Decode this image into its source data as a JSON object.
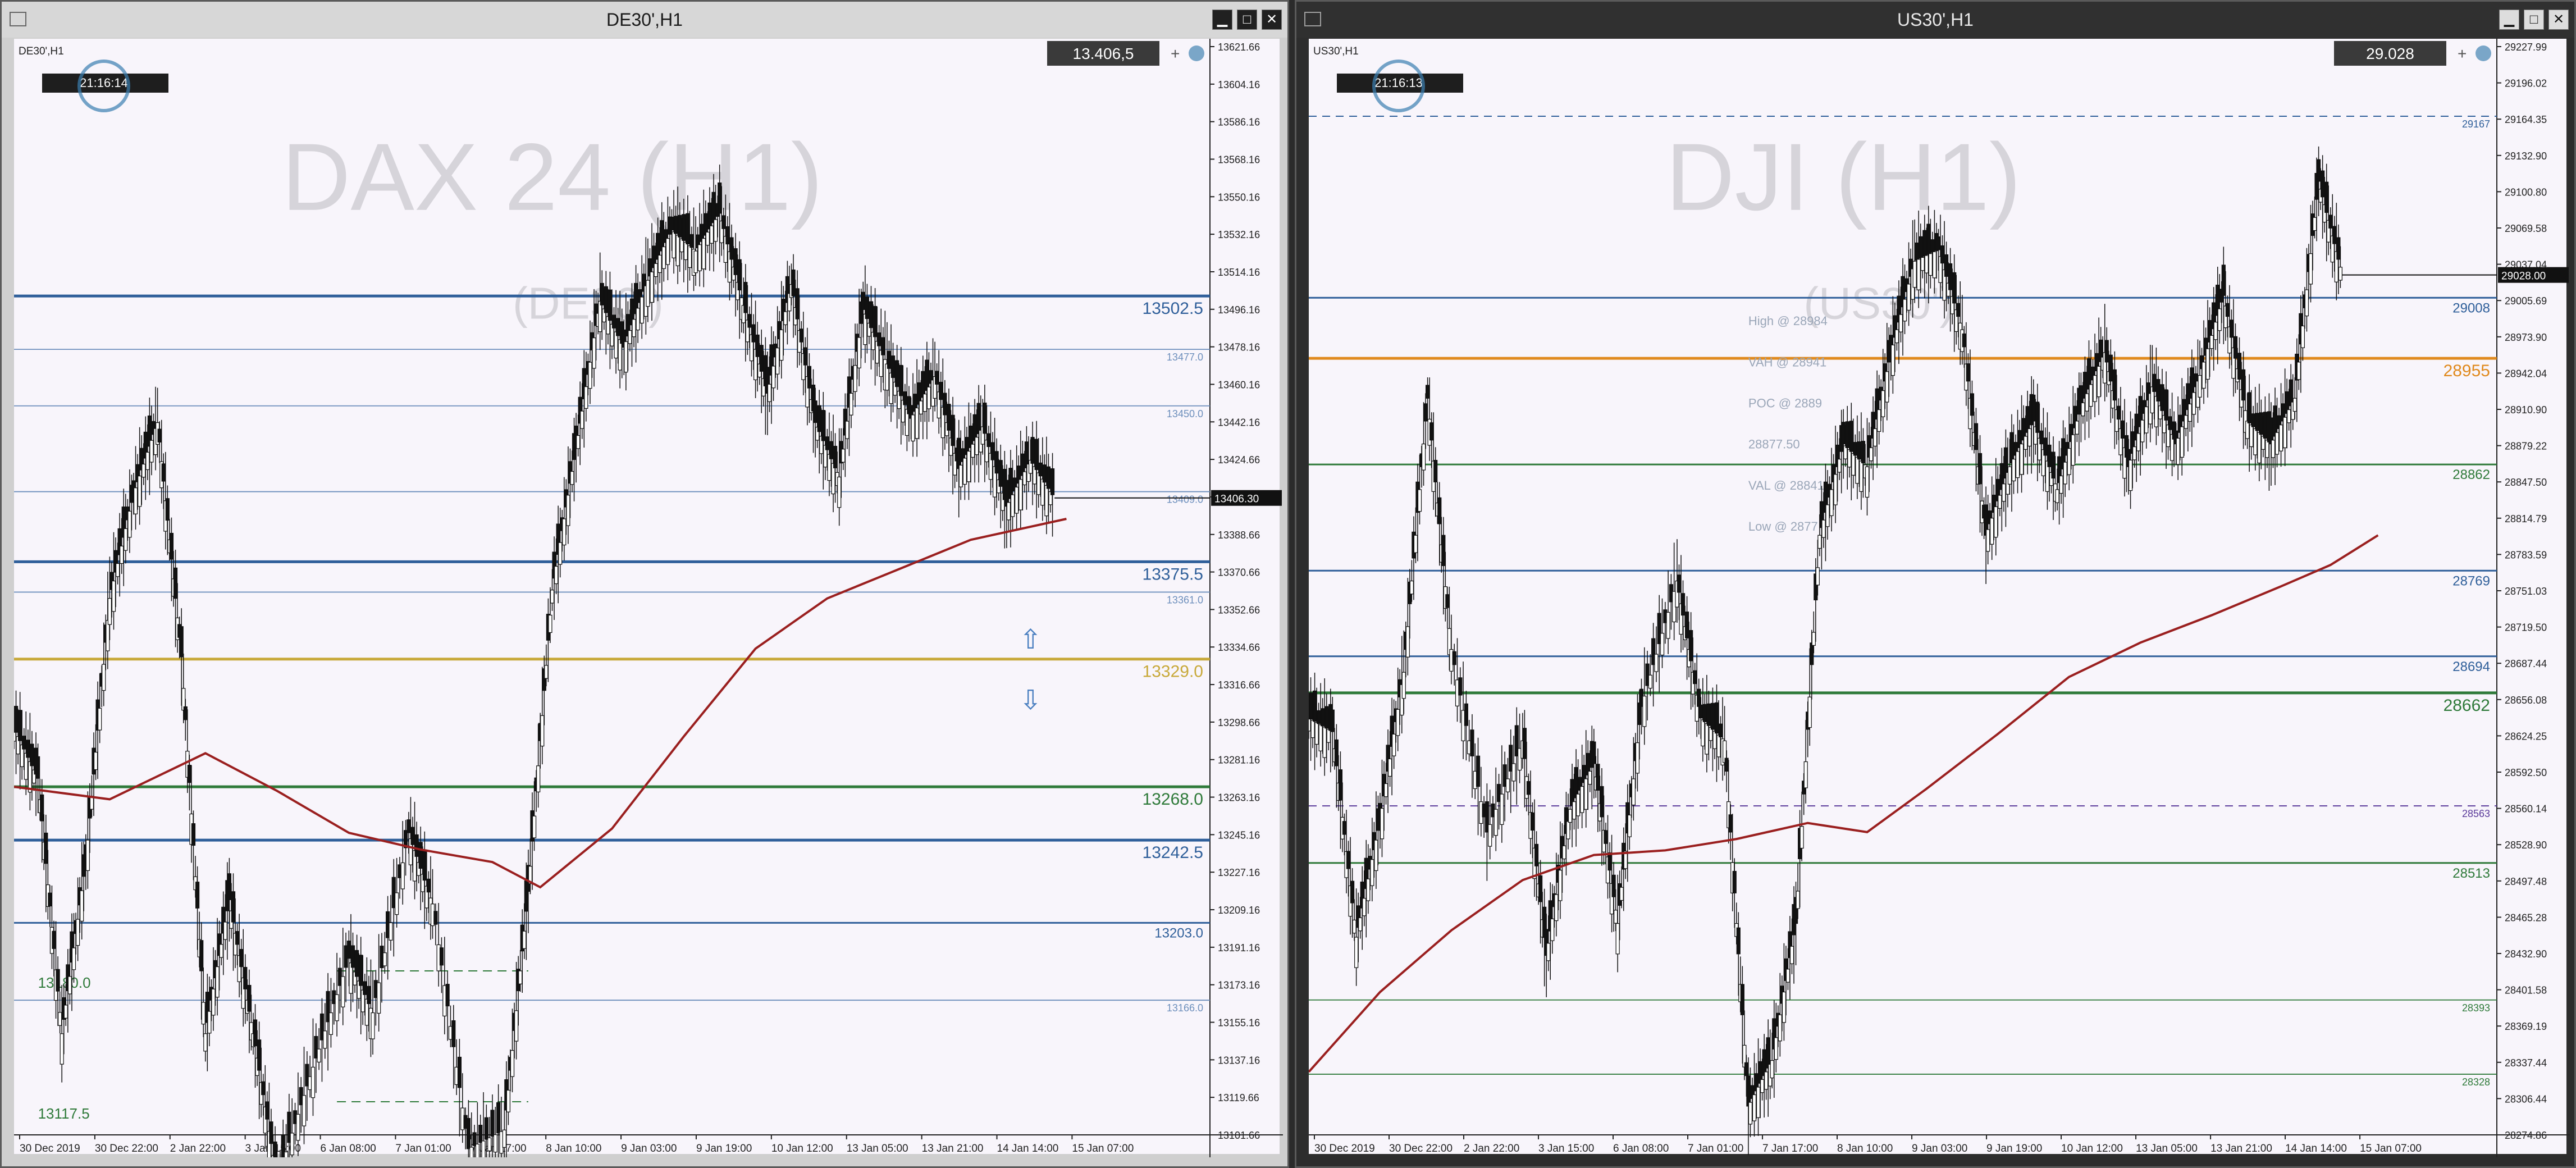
{
  "colors": {
    "price_line": "#2f5f9a",
    "res_light": "#6d8fbc",
    "yellow": "#c8a93a",
    "green": "#2f7a3a",
    "orange": "#e08a1e",
    "purple": "#5a3a9a",
    "ma": "#9a1f1f",
    "candle": "#111111",
    "watermark": "#d6d4da"
  },
  "windows": [
    {
      "title": "DE30',H1",
      "buttons": [
        "▁",
        "□",
        "✕"
      ],
      "icon": "window-icon"
    },
    {
      "title": "US30',H1",
      "buttons": [
        "▁",
        "□",
        "✕"
      ],
      "icon": "window-icon"
    }
  ],
  "chart_data": [
    {
      "type": "candlestick",
      "title": "DE30',H1",
      "watermark": [
        "DAX 24 (H1)",
        "(DE30')"
      ],
      "clock": "21:16:14",
      "price_box": "13.406,5",
      "current_price_tag": "13406.30",
      "ylim": [
        13101.66,
        13621.66
      ],
      "y_ticks": [
        "13621.66",
        "13604.16",
        "13586.16",
        "13568.16",
        "13550.16",
        "13532.16",
        "13514.16",
        "13496.16",
        "13478.16",
        "13460.16",
        "13442.16",
        "13424.66",
        "13406.66",
        "13388.66",
        "13370.66",
        "13352.66",
        "13334.66",
        "13316.66",
        "13298.66",
        "13281.16",
        "13263.16",
        "13245.16",
        "13227.16",
        "13209.16",
        "13191.16",
        "13173.16",
        "13155.16",
        "13137.16",
        "13119.66",
        "13101.66"
      ],
      "x_ticks": [
        "30 Dec 2019",
        "30 Dec 22:00",
        "2 Jan 22:00",
        "3 Jan 15:00",
        "6 Jan 08:00",
        "7 Jan 01:00",
        "7 Jan 17:00",
        "8 Jan 10:00",
        "9 Jan 03:00",
        "9 Jan 19:00",
        "10 Jan 12:00",
        "13 Jan 05:00",
        "13 Jan 21:00",
        "14 Jan 14:00",
        "15 Jan 07:00"
      ],
      "levels": [
        {
          "label": "13502.5",
          "value": 13502.5,
          "style": "thick",
          "color": "price_line"
        },
        {
          "label": "13477.0",
          "value": 13477,
          "style": "thin",
          "color": "res_light"
        },
        {
          "label": "13450.0",
          "value": 13450,
          "style": "thin",
          "color": "res_light"
        },
        {
          "label": "13409.0",
          "value": 13409,
          "style": "thin",
          "color": "res_light"
        },
        {
          "label": "13375.5",
          "value": 13375.5,
          "style": "thick",
          "color": "price_line"
        },
        {
          "label": "13361.0",
          "value": 13361,
          "style": "thin",
          "color": "res_light"
        },
        {
          "label": "13329.0",
          "value": 13329,
          "style": "thick",
          "color": "yellow"
        },
        {
          "label": "13268.0",
          "value": 13268,
          "style": "thick",
          "color": "green"
        },
        {
          "label": "13242.5",
          "value": 13242.5,
          "style": "thick",
          "color": "price_line"
        },
        {
          "label": "13203.0",
          "value": 13203,
          "style": "mid",
          "color": "price_line"
        },
        {
          "label": "13166.0",
          "value": 13166,
          "style": "thin",
          "color": "res_light"
        }
      ],
      "side_labels": [
        {
          "label": "13180.0",
          "value": 13180,
          "color": "green"
        },
        {
          "label": "13117.5",
          "value": 13117.5,
          "color": "green"
        }
      ],
      "ma_path": [
        [
          0,
          13268
        ],
        [
          0.08,
          13262
        ],
        [
          0.16,
          13284
        ],
        [
          0.22,
          13266
        ],
        [
          0.28,
          13246
        ],
        [
          0.34,
          13238
        ],
        [
          0.4,
          13232
        ],
        [
          0.44,
          13220
        ],
        [
          0.5,
          13248
        ],
        [
          0.56,
          13292
        ],
        [
          0.62,
          13334
        ],
        [
          0.68,
          13358
        ],
        [
          0.74,
          13372
        ],
        [
          0.8,
          13386
        ],
        [
          0.88,
          13396
        ]
      ],
      "price_path": [
        [
          0,
          13296
        ],
        [
          0.02,
          13272
        ],
        [
          0.04,
          13150
        ],
        [
          0.06,
          13232
        ],
        [
          0.08,
          13358
        ],
        [
          0.1,
          13408
        ],
        [
          0.12,
          13442
        ],
        [
          0.14,
          13330
        ],
        [
          0.16,
          13150
        ],
        [
          0.18,
          13214
        ],
        [
          0.2,
          13150
        ],
        [
          0.22,
          13080
        ],
        [
          0.25,
          13134
        ],
        [
          0.28,
          13186
        ],
        [
          0.3,
          13160
        ],
        [
          0.33,
          13246
        ],
        [
          0.35,
          13212
        ],
        [
          0.38,
          13095
        ],
        [
          0.41,
          13104
        ],
        [
          0.43,
          13218
        ],
        [
          0.45,
          13362
        ],
        [
          0.47,
          13430
        ],
        [
          0.49,
          13500
        ],
        [
          0.51,
          13478
        ],
        [
          0.53,
          13510
        ],
        [
          0.55,
          13534
        ],
        [
          0.57,
          13524
        ],
        [
          0.59,
          13542
        ],
        [
          0.61,
          13498
        ],
        [
          0.63,
          13456
        ],
        [
          0.65,
          13508
        ],
        [
          0.67,
          13442
        ],
        [
          0.69,
          13416
        ],
        [
          0.71,
          13496
        ],
        [
          0.73,
          13470
        ],
        [
          0.75,
          13444
        ],
        [
          0.77,
          13464
        ],
        [
          0.79,
          13420
        ],
        [
          0.81,
          13440
        ],
        [
          0.83,
          13402
        ],
        [
          0.85,
          13424
        ],
        [
          0.87,
          13406
        ]
      ]
    },
    {
      "type": "candlestick",
      "title": "US30',H1",
      "watermark": [
        "DJI (H1)",
        "(US30')"
      ],
      "clock": "21:16:13",
      "price_box": "29.028",
      "current_price_tag": "29028.00",
      "ylim": [
        28274.86,
        29227.99
      ],
      "y_ticks": [
        "29227.99",
        "29196.02",
        "29164.35",
        "29132.90",
        "29100.80",
        "29069.58",
        "29037.04",
        "29005.69",
        "28973.90",
        "28942.04",
        "28910.90",
        "28879.22",
        "28847.50",
        "28814.79",
        "28783.59",
        "28751.03",
        "28719.50",
        "28687.44",
        "28656.08",
        "28624.25",
        "28592.50",
        "28560.14",
        "28528.90",
        "28497.48",
        "28465.28",
        "28432.90",
        "28401.58",
        "28369.19",
        "28337.44",
        "28306.44",
        "28274.86"
      ],
      "x_ticks": [
        "30 Dec 2019",
        "30 Dec 22:00",
        "2 Jan 22:00",
        "3 Jan 15:00",
        "6 Jan 08:00",
        "7 Jan 01:00",
        "7 Jan 17:00",
        "8 Jan 10:00",
        "9 Jan 03:00",
        "9 Jan 19:00",
        "10 Jan 12:00",
        "13 Jan 05:00",
        "13 Jan 21:00",
        "14 Jan 14:00",
        "15 Jan 07:00"
      ],
      "levels": [
        {
          "label": "29167",
          "value": 29167,
          "style": "dashed",
          "color": "price_line"
        },
        {
          "label": "29008",
          "value": 29008,
          "style": "mid",
          "color": "price_line"
        },
        {
          "label": "28955",
          "value": 28955,
          "style": "thick",
          "color": "orange"
        },
        {
          "label": "28862",
          "value": 28862,
          "style": "mid",
          "color": "green"
        },
        {
          "label": "28769",
          "value": 28769,
          "style": "mid",
          "color": "price_line"
        },
        {
          "label": "28694",
          "value": 28694,
          "style": "mid",
          "color": "price_line"
        },
        {
          "label": "28662",
          "value": 28662,
          "style": "thick",
          "color": "green"
        },
        {
          "label": "28563",
          "value": 28563,
          "style": "dashed",
          "color": "purple"
        },
        {
          "label": "28513",
          "value": 28513,
          "style": "mid",
          "color": "green"
        },
        {
          "label": "28393",
          "value": 28393,
          "style": "thin",
          "color": "green"
        },
        {
          "label": "28328",
          "value": 28328,
          "style": "thin",
          "color": "green"
        }
      ],
      "profile_labels": [
        "High @ 28984",
        "VAH @ 28941",
        "POC @ 2889",
        "28877.50",
        "VAL @ 28841",
        "Low @ 2877"
      ],
      "ma_path": [
        [
          0,
          28330
        ],
        [
          0.06,
          28400
        ],
        [
          0.12,
          28454
        ],
        [
          0.18,
          28498
        ],
        [
          0.24,
          28520
        ],
        [
          0.3,
          28524
        ],
        [
          0.36,
          28534
        ],
        [
          0.42,
          28548
        ],
        [
          0.47,
          28540
        ],
        [
          0.52,
          28578
        ],
        [
          0.58,
          28626
        ],
        [
          0.64,
          28676
        ],
        [
          0.7,
          28706
        ],
        [
          0.76,
          28730
        ],
        [
          0.82,
          28756
        ],
        [
          0.86,
          28774
        ],
        [
          0.9,
          28800
        ]
      ],
      "price_path": [
        [
          0,
          28640
        ],
        [
          0.02,
          28628
        ],
        [
          0.04,
          28448
        ],
        [
          0.06,
          28550
        ],
        [
          0.08,
          28680
        ],
        [
          0.1,
          28920
        ],
        [
          0.12,
          28700
        ],
        [
          0.15,
          28540
        ],
        [
          0.18,
          28620
        ],
        [
          0.2,
          28432
        ],
        [
          0.22,
          28560
        ],
        [
          0.24,
          28600
        ],
        [
          0.26,
          28460
        ],
        [
          0.28,
          28650
        ],
        [
          0.31,
          28760
        ],
        [
          0.33,
          28640
        ],
        [
          0.35,
          28620
        ],
        [
          0.37,
          28300
        ],
        [
          0.39,
          28340
        ],
        [
          0.41,
          28460
        ],
        [
          0.43,
          28800
        ],
        [
          0.45,
          28880
        ],
        [
          0.47,
          28860
        ],
        [
          0.49,
          28960
        ],
        [
          0.51,
          29040
        ],
        [
          0.53,
          29050
        ],
        [
          0.55,
          28980
        ],
        [
          0.57,
          28800
        ],
        [
          0.59,
          28860
        ],
        [
          0.61,
          28900
        ],
        [
          0.63,
          28840
        ],
        [
          0.65,
          28912
        ],
        [
          0.67,
          28960
        ],
        [
          0.69,
          28860
        ],
        [
          0.71,
          28930
        ],
        [
          0.73,
          28880
        ],
        [
          0.75,
          28940
        ],
        [
          0.77,
          29010
        ],
        [
          0.79,
          28900
        ],
        [
          0.81,
          28880
        ],
        [
          0.83,
          28920
        ],
        [
          0.85,
          29110
        ],
        [
          0.87,
          29028
        ]
      ]
    }
  ]
}
